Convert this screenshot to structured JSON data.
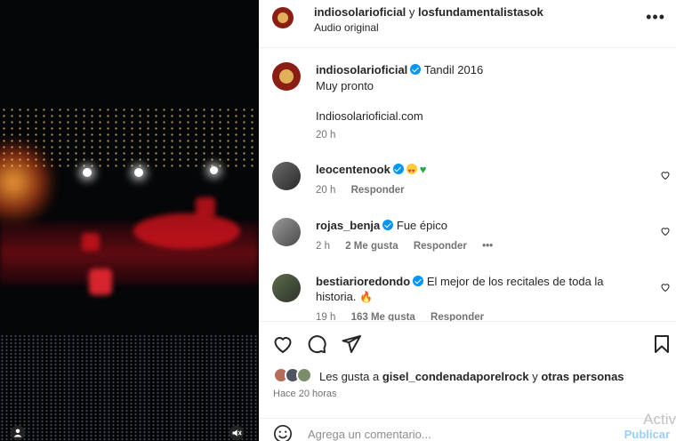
{
  "header": {
    "user1": "indiosolarioficial",
    "connector": "y",
    "user2": "losfundamentalistasok",
    "subtitle": "Audio original",
    "more_label": "•••"
  },
  "caption": {
    "user": "indiosolarioficial",
    "line1": "Tandil 2016",
    "line2": "Muy pronto",
    "line3": "Indiosolarioficial.com",
    "time": "20 h"
  },
  "comments": [
    {
      "user": "leocentenook",
      "text": "",
      "time": "20 h",
      "likes": "",
      "reply": "Responder",
      "emojis": [
        "heart-eyes",
        "green-heart"
      ]
    },
    {
      "user": "rojas_benja",
      "text": "Fue épico",
      "time": "2 h",
      "likes": "2 Me gusta",
      "reply": "Responder",
      "more": "•••"
    },
    {
      "user": "bestiarioredondo",
      "text": "El mejor de los recitales de toda la",
      "text2": "historia.",
      "time": "19 h",
      "likes": "163 Me gusta",
      "reply": "Responder",
      "emojis": [
        "fire"
      ]
    }
  ],
  "likes": {
    "prefix": "Les gusta a",
    "user": "gisel_condenadaporelrock",
    "middle": "y",
    "suffix": "otras personas"
  },
  "timestamp": "Hace 20 horas",
  "composer": {
    "placeholder": "Agrega un comentario...",
    "publish": "Publicar"
  },
  "watermark": "Activ",
  "colors": {
    "verified": "#0095f6",
    "secondary": "#737373",
    "publish": "#9bcdfa"
  },
  "icons": [
    "heart-icon",
    "comment-icon",
    "share-icon",
    "bookmark-icon",
    "emoji-icon",
    "mute-icon",
    "user-tag-icon",
    "more-icon"
  ]
}
